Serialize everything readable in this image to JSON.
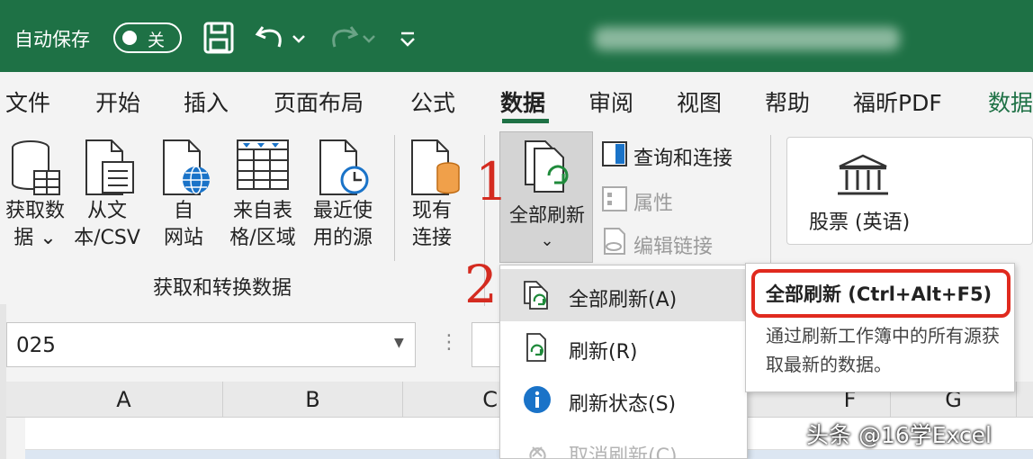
{
  "titlebar": {
    "autosave_label": "自动保存",
    "autosave_state": "关"
  },
  "tabs": [
    "文件",
    "开始",
    "插入",
    "页面布局",
    "公式",
    "数据",
    "审阅",
    "视图",
    "帮助",
    "福昕PDF",
    "数据"
  ],
  "active_tab": "数据",
  "ribbon": {
    "get_data": [
      "获取数",
      "据 ⌄"
    ],
    "from_text": [
      "从文",
      "本/CSV"
    ],
    "from_web": [
      "自",
      "网站"
    ],
    "from_table": [
      "来自表",
      "格/区域"
    ],
    "recent_sources": [
      "最近使",
      "用的源"
    ],
    "existing": [
      "现有",
      "连接"
    ],
    "group_label": "获取和转换数据",
    "refresh_all": "全部刷新",
    "refresh_all_arrow": "⌄",
    "queries": "查询和连接",
    "properties": "属性",
    "edit_links": "编辑链接",
    "stocks": "股票 (英语)"
  },
  "annotations": {
    "one": "1",
    "two": "2"
  },
  "namebox_value": "025",
  "columns": [
    "A",
    "B",
    "C",
    "F",
    "G"
  ],
  "menu": [
    {
      "label": "全部刷新(A)",
      "icon": "refresh-all-icon"
    },
    {
      "label": "刷新(R)",
      "icon": "refresh-icon"
    },
    {
      "label": "刷新状态(S)",
      "icon": "info-icon"
    },
    {
      "label": "取消刷新(C)",
      "icon": "cancel-refresh-icon"
    }
  ],
  "tooltip": {
    "title": "全部刷新 (Ctrl+Alt+F5)",
    "body": "通过刷新工作簿中的所有源获取最新的数据。"
  },
  "watermark": "头条 @16学Excel",
  "colors": {
    "excel_green": "#1e7145",
    "annotation_red": "#d42b20"
  }
}
